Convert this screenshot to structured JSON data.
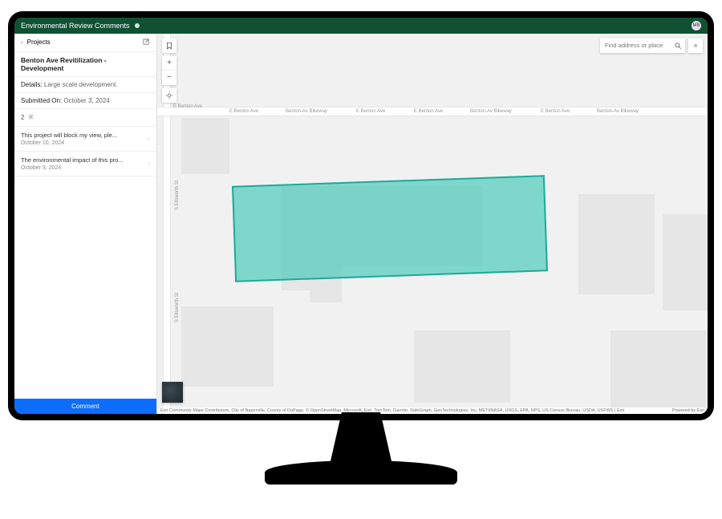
{
  "header": {
    "title": "Environmental Review Comments",
    "avatar_initials": "MB"
  },
  "sidebar": {
    "back_label": "Projects",
    "project_title": "Benton Ave Revitilization - Development",
    "details_label": "Details:",
    "details_value": "Large scale development.",
    "submitted_label": "Submitted On:",
    "submitted_value": "October 3, 2024",
    "comment_count": "2",
    "comments": [
      {
        "text": "This project will block my view, ple...",
        "date": "October 10, 2024"
      },
      {
        "text": "The environmental impact of this pro...",
        "date": "October 3, 2024"
      }
    ],
    "comment_button": "Comment"
  },
  "map": {
    "search_placeholder": "Find address or place",
    "road_labels": [
      "E Benton Ave",
      "E Benton Ave",
      "Benton-Av Bikeway",
      "E Benton Ave",
      "E Benton Ave",
      "Benton-Av Bikeway",
      "E Benton Ave",
      "Benton-Av Bikeway"
    ],
    "vroad_label_1": "S Ellsworth St",
    "vroad_label_2": "S Ellsworth St",
    "zoom_in": "+",
    "zoom_out": "−",
    "attribution_left": "Esri Community Maps Contributors, City of Naperville, County of DuPage, © OpenStreetMap, Microsoft, Esri, TomTom, Garmin, SafeGraph, GeoTechnologies, Inc, METI/NASA, USGS, EPA, NPS, US Census Bureau, USDA, USFWS | Esri",
    "attribution_right": "Powered by Esri"
  }
}
